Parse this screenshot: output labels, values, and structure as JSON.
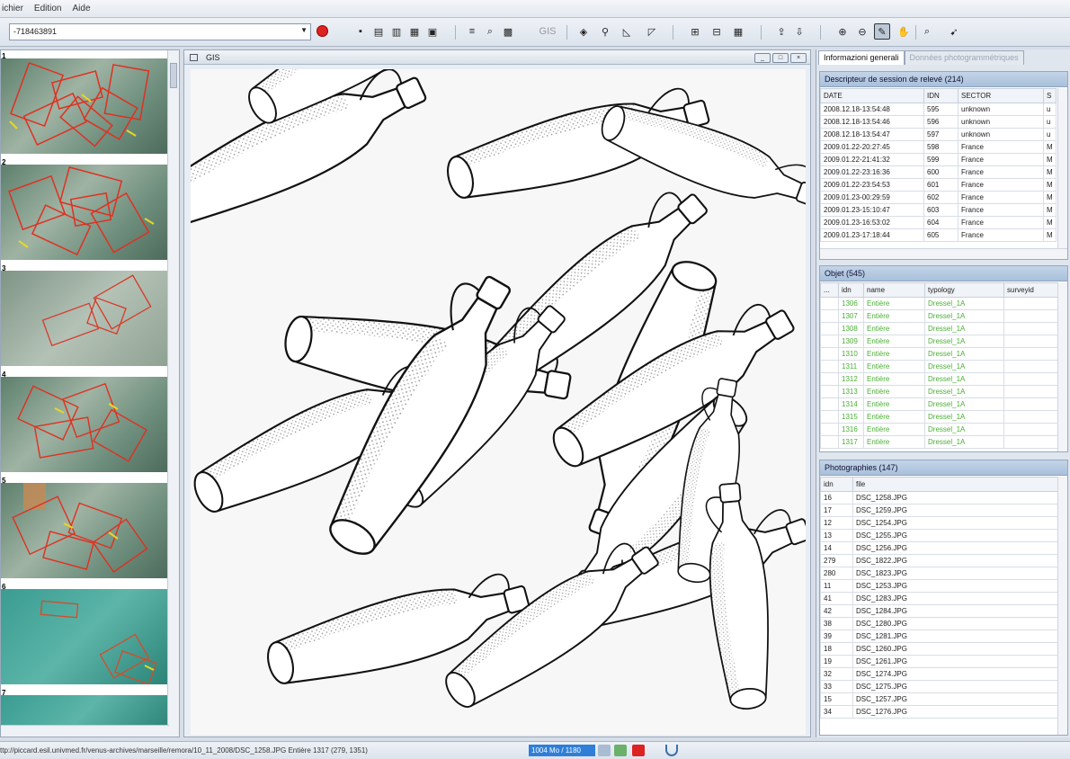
{
  "menu": [
    "ichier",
    "Edition",
    "Aide"
  ],
  "toolbar": {
    "combo_value": "-718463891",
    "gis_label": "GIS"
  },
  "thumbnails": [
    {
      "num": "1"
    },
    {
      "num": "2"
    },
    {
      "num": "3"
    },
    {
      "num": "4"
    },
    {
      "num": "5"
    },
    {
      "num": "6"
    },
    {
      "num": "7"
    }
  ],
  "gis": {
    "title": "GIS"
  },
  "tabs": [
    "Informazioni generali",
    "Données photogrammétriques"
  ],
  "sessions": {
    "title": "Descripteur de session de relevé (214)",
    "columns": [
      "DATE",
      "IDN",
      "SECTOR",
      "S"
    ],
    "rows": [
      [
        "2008.12.18-13:54:48",
        "595",
        "unknown",
        "u"
      ],
      [
        "2008.12.18-13:54:46",
        "596",
        "unknown",
        "u"
      ],
      [
        "2008.12.18-13:54:47",
        "597",
        "unknown",
        "u"
      ],
      [
        "2009.01.22-20:27:45",
        "598",
        "France",
        "M"
      ],
      [
        "2009.01.22-21:41:32",
        "599",
        "France",
        "M"
      ],
      [
        "2009.01.22-23:16:36",
        "600",
        "France",
        "M"
      ],
      [
        "2009.01.22-23:54:53",
        "601",
        "France",
        "M"
      ],
      [
        "2009.01.23-00:29:59",
        "602",
        "France",
        "M"
      ],
      [
        "2009.01.23-15:10:47",
        "603",
        "France",
        "M"
      ],
      [
        "2009.01.23-16:53:02",
        "604",
        "France",
        "M"
      ],
      [
        "2009.01.23-17:18:44",
        "605",
        "France",
        "M"
      ]
    ]
  },
  "objects": {
    "title": "Objet (545)",
    "columns": [
      "...",
      "idn",
      "name",
      "typology",
      "surveyid"
    ],
    "rows": [
      [
        "",
        "1306",
        "Entière",
        "Dressel_1A",
        ""
      ],
      [
        "",
        "1307",
        "Entière",
        "Dressel_1A",
        ""
      ],
      [
        "",
        "1308",
        "Entière",
        "Dressel_1A",
        ""
      ],
      [
        "",
        "1309",
        "Entière",
        "Dressel_1A",
        ""
      ],
      [
        "",
        "1310",
        "Entière",
        "Dressel_1A",
        ""
      ],
      [
        "",
        "1311",
        "Entière",
        "Dressel_1A",
        ""
      ],
      [
        "",
        "1312",
        "Entière",
        "Dressel_1A",
        ""
      ],
      [
        "",
        "1313",
        "Entière",
        "Dressel_1A",
        ""
      ],
      [
        "",
        "1314",
        "Entière",
        "Dressel_1A",
        ""
      ],
      [
        "",
        "1315",
        "Entière",
        "Dressel_1A",
        ""
      ],
      [
        "",
        "1316",
        "Entière",
        "Dressel_1A",
        ""
      ],
      [
        "",
        "1317",
        "Entière",
        "Dressel_1A",
        ""
      ]
    ]
  },
  "photos": {
    "title": "Photographies (147)",
    "columns": [
      "idn",
      "file"
    ],
    "rows": [
      [
        "16",
        "DSC_1258.JPG"
      ],
      [
        "17",
        "DSC_1259.JPG"
      ],
      [
        "12",
        "DSC_1254.JPG"
      ],
      [
        "13",
        "DSC_1255.JPG"
      ],
      [
        "14",
        "DSC_1256.JPG"
      ],
      [
        "279",
        "DSC_1822.JPG"
      ],
      [
        "280",
        "DSC_1823.JPG"
      ],
      [
        "11",
        "DSC_1253.JPG"
      ],
      [
        "41",
        "DSC_1283.JPG"
      ],
      [
        "42",
        "DSC_1284.JPG"
      ],
      [
        "38",
        "DSC_1280.JPG"
      ],
      [
        "39",
        "DSC_1281.JPG"
      ],
      [
        "18",
        "DSC_1260.JPG"
      ],
      [
        "19",
        "DSC_1261.JPG"
      ],
      [
        "32",
        "DSC_1274.JPG"
      ],
      [
        "33",
        "DSC_1275.JPG"
      ],
      [
        "15",
        "DSC_1257.JPG"
      ],
      [
        "34",
        "DSC_1276.JPG"
      ]
    ]
  },
  "status": {
    "text": "ttp://piccard.esil.univmed.fr/venus-archives/marseille/remora/10_11_2008/DSC_1258.JPG Entière 1317 (279, 1351)",
    "memory": "1004 Mo / 1180"
  },
  "colors": {
    "accent": "#2f7fd8",
    "green_text": "#4caf36",
    "stop": "#dd2222"
  }
}
